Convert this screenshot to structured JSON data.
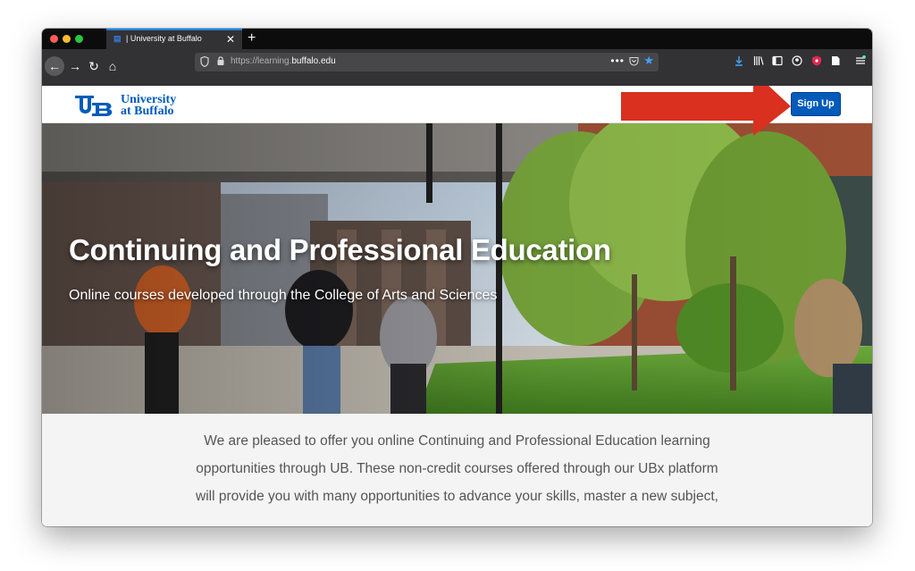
{
  "browser": {
    "tab": {
      "title": "| University at Buffalo",
      "close_glyph": "✕",
      "new_tab_glyph": "+"
    },
    "url": {
      "prefix": "https://learning.",
      "domain": "buffalo.edu",
      "more_glyph": "•••"
    },
    "nav": {
      "back": "←",
      "forward": "→",
      "reload": "↻",
      "home": "⌂"
    },
    "icons": [
      "shield-icon",
      "lock-icon",
      "pocket-icon",
      "star-icon",
      "download-icon",
      "library-icon",
      "sidebar-icon",
      "account-icon",
      "extension-icon",
      "reader-icon",
      "menu-icon"
    ]
  },
  "site": {
    "logo": {
      "line1": "University",
      "line2": "at Buffalo",
      "color": "#005bbb"
    },
    "signup_label": "Sign Up"
  },
  "hero": {
    "title": "Continuing and Professional Education",
    "subtitle": "Online courses developed through the College of Arts and Sciences"
  },
  "intro": {
    "lines": [
      "We are pleased to offer you online Continuing and Professional Education learning",
      "opportunities through UB. These non-credit courses offered through our UBx platform",
      "will provide you with many opportunities to advance your skills, master a new subject,"
    ]
  },
  "colors": {
    "accent": "#005bbb",
    "annotation_arrow": "#d9301f",
    "star": "#45a1ff"
  }
}
